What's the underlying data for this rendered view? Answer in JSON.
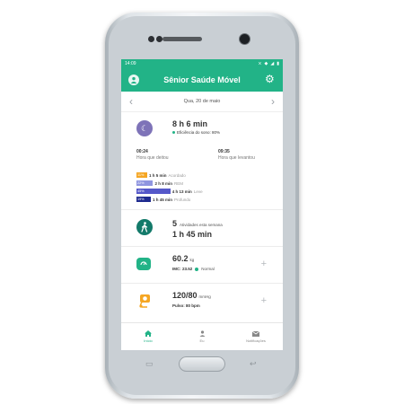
{
  "status": {
    "time": "14:09"
  },
  "app": {
    "title": "Sênior Saúde Móvel"
  },
  "date": {
    "label": "Qua, 20 de maio"
  },
  "sleep": {
    "total": "8 h 6 min",
    "efficiency": "Eficiência do sono: 80%",
    "bed": {
      "time": "00:24",
      "label": "Hora que deitou"
    },
    "wake": {
      "time": "09:35",
      "label": "Hora que levantou"
    },
    "stages": [
      {
        "pct": "11%",
        "duration": "1 h 5 min",
        "name": "Acordado",
        "color": "#f5a623",
        "fraction": 0.11
      },
      {
        "pct": "22%",
        "duration": "2 h 8 min",
        "name": "REM",
        "color": "#8f95e0",
        "fraction": 0.22
      },
      {
        "pct": "45%",
        "duration": "4 h 13 min",
        "name": "Leve",
        "color": "#5558c9",
        "fraction": 0.45
      },
      {
        "pct": "19%",
        "duration": "1 h 45 min",
        "name": "Profundo",
        "color": "#1f2b8f",
        "fraction": 0.19
      }
    ]
  },
  "activity": {
    "count": "5",
    "label": "Atividades esta semana",
    "duration": "1 h 45 min"
  },
  "weight": {
    "value": "60.2",
    "unit": "kg",
    "imc": "IMC: 23.52",
    "status": "Normal"
  },
  "pressure": {
    "value": "120/80",
    "unit": "mmHg",
    "pulse": "Pulso: 80 bpm"
  },
  "nav": {
    "home": "Início",
    "me": "Eu",
    "notifications": "Notificações"
  },
  "colors": {
    "primary": "#22b387",
    "moon": "#7e73b8",
    "activity": "#137a6a",
    "weight": "#22b387",
    "pressure": "#f5a623"
  }
}
